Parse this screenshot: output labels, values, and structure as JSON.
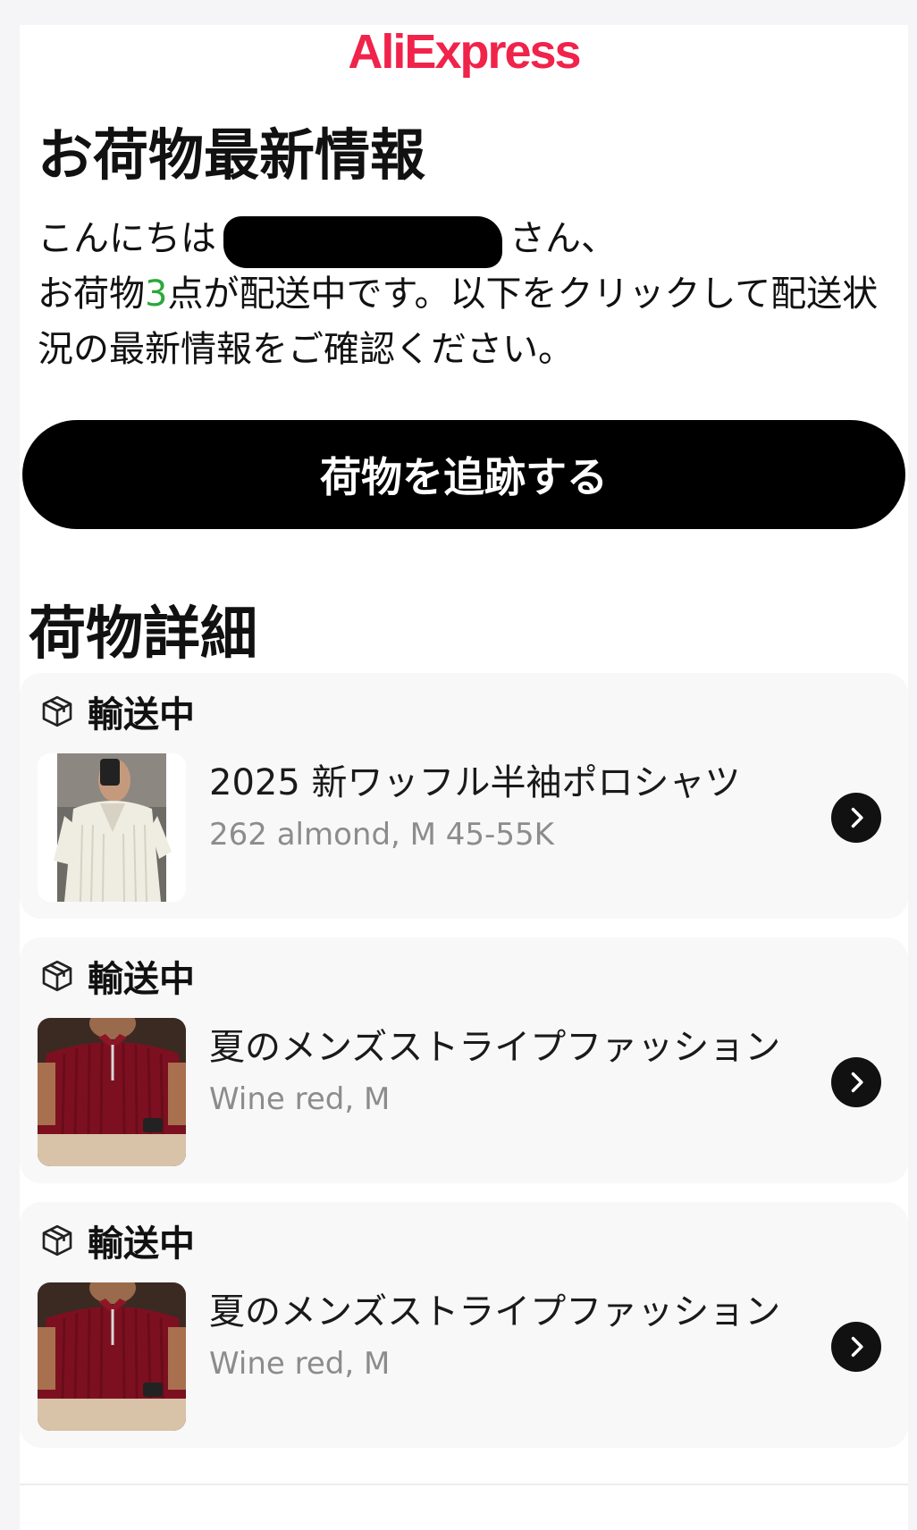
{
  "brand": {
    "logo_text": "AliExpress"
  },
  "email": {
    "title": "お荷物最新情報",
    "greeting_hello": "こんにちは",
    "greeting_suffix": "さん、",
    "message_prefix": "お荷物",
    "message_count": "3",
    "message_rest": "点が配送中です。以下をクリックして配送状況の最新情報をご確認ください。",
    "track_button": "荷物を追跡する",
    "details_title": "荷物詳細"
  },
  "colors": {
    "brand_red": "#f0234b",
    "brand_star": "#f5b21b",
    "count_green": "#2aa83a",
    "button_black": "#000000"
  },
  "packages": [
    {
      "status": "輸送中",
      "icon": "package-icon",
      "name": "2025 新ワッフル半袖ポロシャツ",
      "variant": "262 almond, M 45-55K",
      "thumbnail": "cream-waffle-polo"
    },
    {
      "status": "輸送中",
      "icon": "package-icon",
      "name": "夏のメンズストライプファッション",
      "variant": "Wine red, M",
      "thumbnail": "wine-red-striped-polo"
    },
    {
      "status": "輸送中",
      "icon": "package-icon",
      "name": "夏のメンズストライプファッション",
      "variant": "Wine red, M",
      "thumbnail": "wine-red-striped-polo"
    }
  ]
}
